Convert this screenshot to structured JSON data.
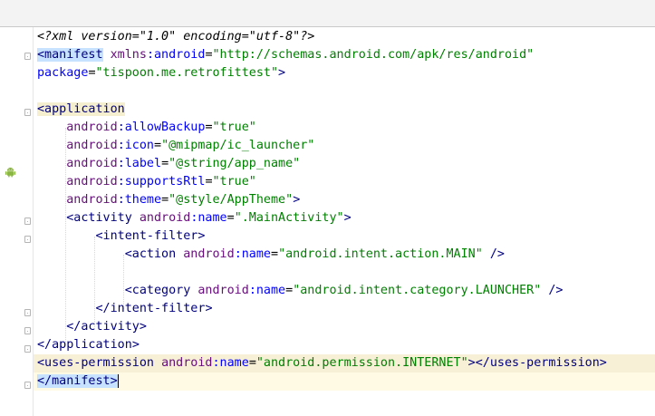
{
  "editor": {
    "lines": [
      {
        "text": "<?xml version=\"1.0\" encoding=\"utf-8\"?>"
      },
      {
        "text": "<manifest xmlns:android=\"http://schemas.android.com/apk/res/android\""
      },
      {
        "text": "package=\"tispoon.me.retrofittest\">"
      },
      {
        "text": ""
      },
      {
        "text": "<application"
      },
      {
        "text": "    android:allowBackup=\"true\""
      },
      {
        "text": "    android:icon=\"@mipmap/ic_launcher\""
      },
      {
        "text": "    android:label=\"@string/app_name\""
      },
      {
        "text": "    android:supportsRtl=\"true\""
      },
      {
        "text": "    android:theme=\"@style/AppTheme\">"
      },
      {
        "text": "    <activity android:name=\".MainActivity\">"
      },
      {
        "text": "        <intent-filter>"
      },
      {
        "text": "            <action android:name=\"android.intent.action.MAIN\" />"
      },
      {
        "text": ""
      },
      {
        "text": "            <category android:name=\"android.intent.category.LAUNCHER\" />"
      },
      {
        "text": "        </intent-filter>"
      },
      {
        "text": "    </activity>"
      },
      {
        "text": "</application>"
      },
      {
        "text": "<uses-permission android:name=\"android.permission.INTERNET\"></uses-permission>"
      },
      {
        "text": "</manifest>"
      }
    ]
  },
  "gutter": {
    "icon": "android-icon"
  },
  "colors": {
    "tag": "#000080",
    "attribute_name": "#660e7a",
    "string_value": "#008000",
    "caret_line": "#fffae3",
    "tag_highlight": "#c7e2ff"
  }
}
